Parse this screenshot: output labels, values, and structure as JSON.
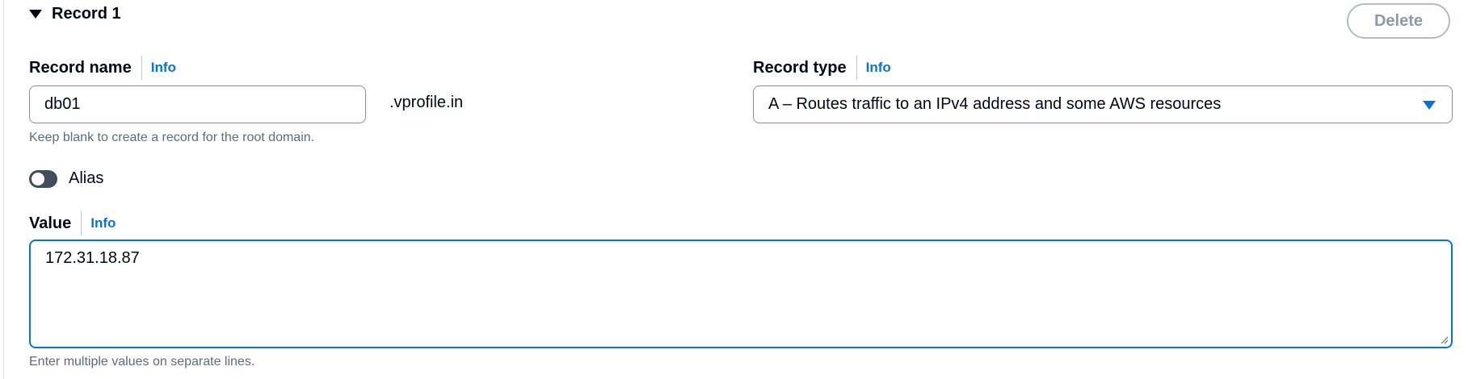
{
  "record": {
    "title": "Record 1",
    "delete_label": "Delete"
  },
  "record_name": {
    "label": "Record name",
    "info": "Info",
    "value": "db01",
    "suffix": ".vprofile.in",
    "hint": "Keep blank to create a record for the root domain."
  },
  "record_type": {
    "label": "Record type",
    "info": "Info",
    "selected": "A – Routes traffic to an IPv4 address and some AWS resources"
  },
  "alias": {
    "label": "Alias",
    "enabled": false
  },
  "value_field": {
    "label": "Value",
    "info": "Info",
    "value": "172.31.18.87",
    "hint": "Enter multiple values on separate lines."
  },
  "colors": {
    "accent": "#0972d3",
    "text": "#000716",
    "hint": "#5f6b7a"
  },
  "icons": {
    "expand": "caret-down-icon",
    "dropdown": "caret-down-filled-icon",
    "resize": "resize-grip-icon"
  }
}
